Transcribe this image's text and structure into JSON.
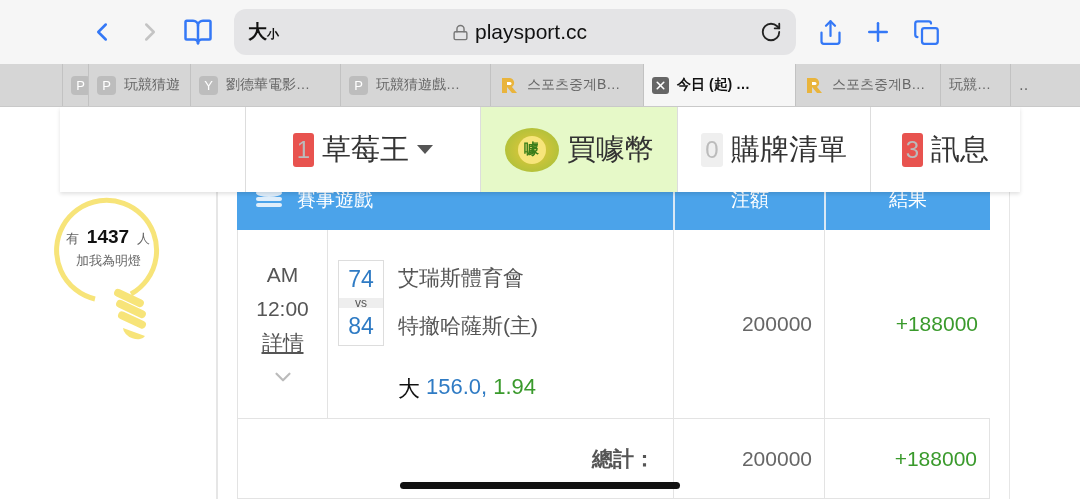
{
  "browser": {
    "size_big": "大",
    "size_small": "小",
    "url": "playsport.cc"
  },
  "tabs": [
    {
      "favicon": {
        "kind": "letter",
        "text": "P"
      },
      "selected": false
    },
    {
      "favicon": {
        "kind": "letter",
        "text": "P"
      },
      "title": "玩競猜遊",
      "selected": false
    },
    {
      "favicon": {
        "kind": "letter",
        "text": "Y"
      },
      "title": "劉德華電影…",
      "selected": false
    },
    {
      "favicon": {
        "kind": "letter",
        "text": "P"
      },
      "title": "玩競猜遊戲…",
      "selected": false
    },
    {
      "favicon": {
        "kind": "logo"
      },
      "title": "스포츠중계B…",
      "selected": false
    },
    {
      "favicon": {
        "kind": "close"
      },
      "title": "今日 (起) …",
      "selected": true
    },
    {
      "favicon": {
        "kind": "logo"
      },
      "title": "스포츠중계B…",
      "selected": false
    },
    {
      "title": "玩競…",
      "selected": false
    },
    {
      "title": "‥",
      "selected": false
    }
  ],
  "site_nav": [
    {
      "kind": "dropdown",
      "badge": {
        "text": "1",
        "color": "#e8534f"
      },
      "label": "草莓王",
      "highlighted": false
    },
    {
      "kind": "coin",
      "coin_mark": "噱",
      "label": "買噱幣",
      "highlighted": true
    },
    {
      "kind": "plain",
      "badge": {
        "text": "0",
        "color": "#efefef"
      },
      "label": "購牌清單",
      "highlighted": false
    },
    {
      "kind": "plain",
      "badge": {
        "text": "3",
        "color": "#e8534f"
      },
      "label": "訊息",
      "highlighted": false
    }
  ],
  "fans": {
    "prefix": "有",
    "count": "1437",
    "suffix": "人",
    "caption": "加我為明燈"
  },
  "table": {
    "columns": [
      "賽事遊戲",
      "注額",
      "結果"
    ],
    "rows": [
      {
        "period": "AM",
        "time": "12:00",
        "details_link": "詳情",
        "scores": [
          "74",
          "84"
        ],
        "vs": "vs",
        "teams": [
          "艾瑞斯體育會",
          "特撤哈薩斯(主)"
        ],
        "pick": {
          "side": "大",
          "line": "156.0,",
          "odds": "1.94"
        },
        "stake": "200000",
        "result": "+188000"
      }
    ],
    "total": {
      "label": "總計：",
      "stake": "200000",
      "result": "+188000"
    }
  }
}
